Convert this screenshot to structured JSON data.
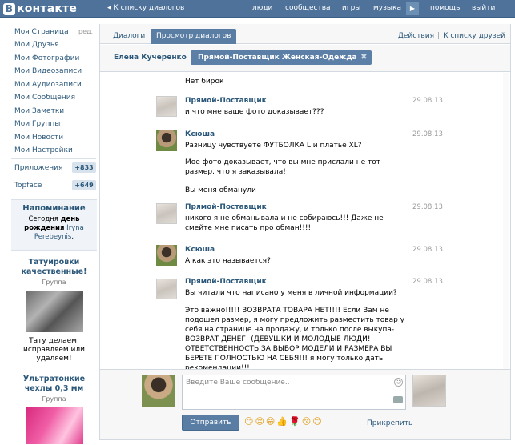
{
  "header": {
    "logo_letter": "В",
    "logo_text": "контакте",
    "back_link": "◂ К списку диалогов",
    "nav": [
      "люди",
      "сообщества",
      "игры",
      "музыка",
      "помощь",
      "выйти"
    ],
    "play_icon": "▶"
  },
  "sidebar": {
    "edit_label": "ред.",
    "items": [
      "Моя Страница",
      "Мои Друзья",
      "Мои Фотографии",
      "Мои Видеозаписи",
      "Мои Аудиозаписи",
      "Мои Сообщения",
      "Мои Заметки",
      "Мои Группы",
      "Мои Новости",
      "Мои Настройки"
    ],
    "apps": [
      {
        "label": "Приложения",
        "badge": "+833"
      },
      {
        "label": "Topface",
        "badge": "+649"
      }
    ],
    "reminder": {
      "title": "Напоминание",
      "text_pre": "Сегодня ",
      "text_bold": "день рождения",
      "name": " Iryna Perebeynis",
      "text_post": "."
    },
    "ads": [
      {
        "title": "Татуировки качественные!",
        "subtitle": "Группа",
        "desc": "Тату делаем, исправляем или удаляем!"
      },
      {
        "title": "Ультратонкие чехлы 0,3 мм",
        "subtitle": "Группа"
      }
    ]
  },
  "tabs": {
    "items": [
      "Диалоги",
      "Просмотр диалогов"
    ],
    "active": 1,
    "right_actions": "Действия",
    "right_sep": "|",
    "right_link": "К списку друзей"
  },
  "chips": [
    {
      "label": "Елена Кучеренко",
      "active": false
    },
    {
      "label": "Прямой-Поставщик Женская-Одежда",
      "active": true
    }
  ],
  "chip_close": "✖",
  "messages": [
    {
      "author": "",
      "date": "",
      "text": "Нет бирок"
    },
    {
      "author": "Прямой-Поставщик",
      "date": "29.08.13",
      "text": "и что мне ваше фото доказывает???"
    },
    {
      "author": "Ксюша",
      "date": "29.08.13",
      "text": "Разницу чувствуете ФУТБОЛКА L и платье XL?"
    },
    {
      "author": "",
      "date": "",
      "text": "Мое фото доказывает, что вы мне прислали не тот размер, что я заказывала!"
    },
    {
      "author": "",
      "date": "",
      "text": "Вы меня обманули"
    },
    {
      "author": "Прямой-Поставщик",
      "date": "29.08.13",
      "text": "никого я не обманывала и не собираюсь!!! Даже не смейте мне писать про обман!!!!"
    },
    {
      "author": "Ксюша",
      "date": "29.08.13",
      "text": "А как это называется?"
    },
    {
      "author": "Прямой-Поставщик",
      "date": "29.08.13",
      "text": "Вы читали что написано у меня в личной информации?"
    },
    {
      "author": "",
      "date": "",
      "text": "Это важно!!!!! ВОЗВРАТА ТОВАРА НЕТ!!!! Если Вам не подошел размер, я могу предложить разместить товар у себя на странице на продажу, и только после выкупа-ВОЗВРАТ ДЕНЕГ! (ДЕВУШКИ И МОЛОДЫЕ ЛЮДИ! ОТВЕТСТВЕННОСТЬ ЗА ВЫБОР МОДЕЛИ И РАЗМЕРА ВЫ БЕРЕТЕ ПОЛНОСТЬЮ НА СЕБЯ!!! я могу только дать рекомендации!!!"
    }
  ],
  "compose": {
    "placeholder": "Введите Ваше сообщение..",
    "send_label": "Отправить",
    "emoji": "😏😔😁👍🌹😚😊",
    "attach_label": "Прикрепить"
  }
}
